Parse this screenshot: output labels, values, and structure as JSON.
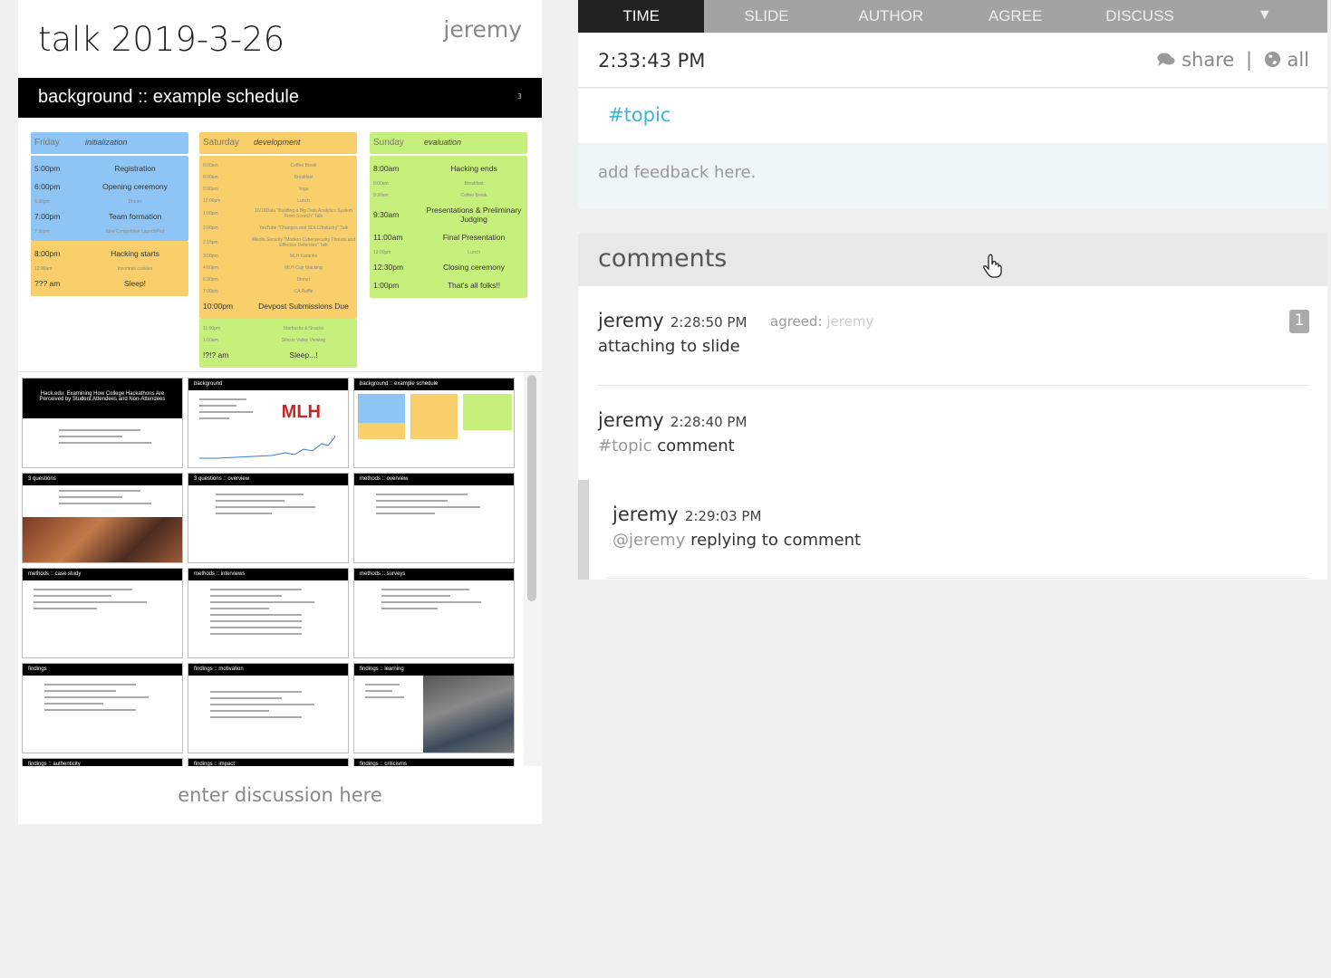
{
  "talk": {
    "title": "talk 2019-3-26",
    "author": "jeremy"
  },
  "slide": {
    "title": "background :: example schedule",
    "number": "3"
  },
  "schedule": {
    "columns": [
      {
        "day": "Friday",
        "name": "initialization",
        "color": "#8ec5f5",
        "events": [
          {
            "time": "5:00pm",
            "name": "Registration"
          },
          {
            "time": "6:00pm",
            "name": "Opening ceremony"
          },
          {
            "time": "6:30pm",
            "name": "Dinner"
          },
          {
            "time": "7:00pm",
            "name": "Team formation"
          },
          {
            "time": "7:30pm",
            "name": "Idea Competition LaunchPad"
          },
          {
            "time": "8:00pm",
            "name": "Hacking starts"
          },
          {
            "time": "12:00am",
            "name": "Insomnia cookies"
          },
          {
            "time": "??? am",
            "name": "Sleep!"
          }
        ]
      },
      {
        "day": "Saturday",
        "name": "development",
        "color": "#f8cf6a",
        "events": [
          {
            "time": "8:00am",
            "name": "Coffee Break"
          },
          {
            "time": "8:00am",
            "name": "Breakfast"
          },
          {
            "time": "9:00am",
            "name": "Yoga"
          },
          {
            "time": "12:00pm",
            "name": "Lunch"
          },
          {
            "time": "1:00pm",
            "name": "10/10Data \"Building a Big Data Analytics System From Scratch\" Talk"
          },
          {
            "time": "2:00pm",
            "name": "YouTube \"Changes and SDLC/Industry\" Talk"
          },
          {
            "time": "2:15pm",
            "name": "iMedia Security \"Modern Cybersecurity Threats and Effective Defenses\" Talk"
          },
          {
            "time": "3:00pm",
            "name": "MLH Karaoke"
          },
          {
            "time": "4:00pm",
            "name": "MLH Cup Stacking"
          },
          {
            "time": "6:30pm",
            "name": "Dinner"
          },
          {
            "time": "7:00pm",
            "name": "CA Raffle"
          },
          {
            "time": "10:00pm",
            "name": "Devpost Submissions Due"
          },
          {
            "time": "11:00pm",
            "name": "Starbucks & Snacks"
          },
          {
            "time": "1:00am",
            "name": "Silicon Valley Viewing"
          },
          {
            "time": "!?!? am",
            "name": "Sleep...!"
          }
        ]
      },
      {
        "day": "Sunday",
        "name": "evaluation",
        "color": "#c7ef7c",
        "events": [
          {
            "time": "8:00am",
            "name": "Hacking ends"
          },
          {
            "time": "8:00am",
            "name": "Breakfast"
          },
          {
            "time": "9:30am",
            "name": "Coffee Break"
          },
          {
            "time": "9:30am",
            "name": "Presentations & Preliminary Judging"
          },
          {
            "time": "11:00am",
            "name": "Final Presentation"
          },
          {
            "time": "12:00pm",
            "name": "Lunch"
          },
          {
            "time": "12:30pm",
            "name": "Closing ceremony"
          },
          {
            "time": "1:00pm",
            "name": "That's all folks!!"
          }
        ]
      }
    ]
  },
  "thumbnails": [
    {
      "title": "Hack.edu: Examining How College Hackathons Are Perceived by Student Attendees and Non-Attendees",
      "kind": "title"
    },
    {
      "title": "background",
      "kind": "chart"
    },
    {
      "title": "background :: example schedule",
      "kind": "schedule"
    },
    {
      "title": "3 questions",
      "kind": "photo"
    },
    {
      "title": "3 questions :: overview",
      "kind": "text"
    },
    {
      "title": "methods :: overview",
      "kind": "text"
    },
    {
      "title": "methods :: case study",
      "kind": "text"
    },
    {
      "title": "methods :: interviews",
      "kind": "text"
    },
    {
      "title": "methods :: surveys",
      "kind": "text"
    },
    {
      "title": "findings",
      "kind": "text"
    },
    {
      "title": "findings :: motivation",
      "kind": "text"
    },
    {
      "title": "findings :: learning",
      "kind": "photo2"
    },
    {
      "title": "findings :: authenticity",
      "kind": "text"
    },
    {
      "title": "findings :: impact",
      "kind": "text"
    },
    {
      "title": "findings :: criticisms",
      "kind": "text"
    }
  ],
  "discussion_placeholder": "enter discussion here",
  "tabs": [
    "TIME",
    "SLIDE",
    "AUTHOR",
    "AGREE",
    "DISCUSS",
    "▼"
  ],
  "header": {
    "time": "2:33:43 PM",
    "share": "share",
    "sep": "|",
    "all": "all"
  },
  "topic": "#topic",
  "feedback_placeholder": "add feedback here.",
  "comments_title": "comments",
  "comments": [
    {
      "author": "jeremy",
      "time": "2:28:50 PM",
      "agreed_label": "agreed:",
      "agreed_by": "jeremy",
      "text": "attaching to slide",
      "count": "1"
    },
    {
      "author": "jeremy",
      "time": "2:28:40 PM",
      "tag": "#topic",
      "text": " comment"
    },
    {
      "author": "jeremy",
      "time": "2:29:03 PM",
      "mention": "@jeremy",
      "text": " replying to comment"
    }
  ],
  "colors": {
    "topic": "#3ab5d9",
    "tab_active": "#222222",
    "tab_bar": "#a3a3a3"
  }
}
